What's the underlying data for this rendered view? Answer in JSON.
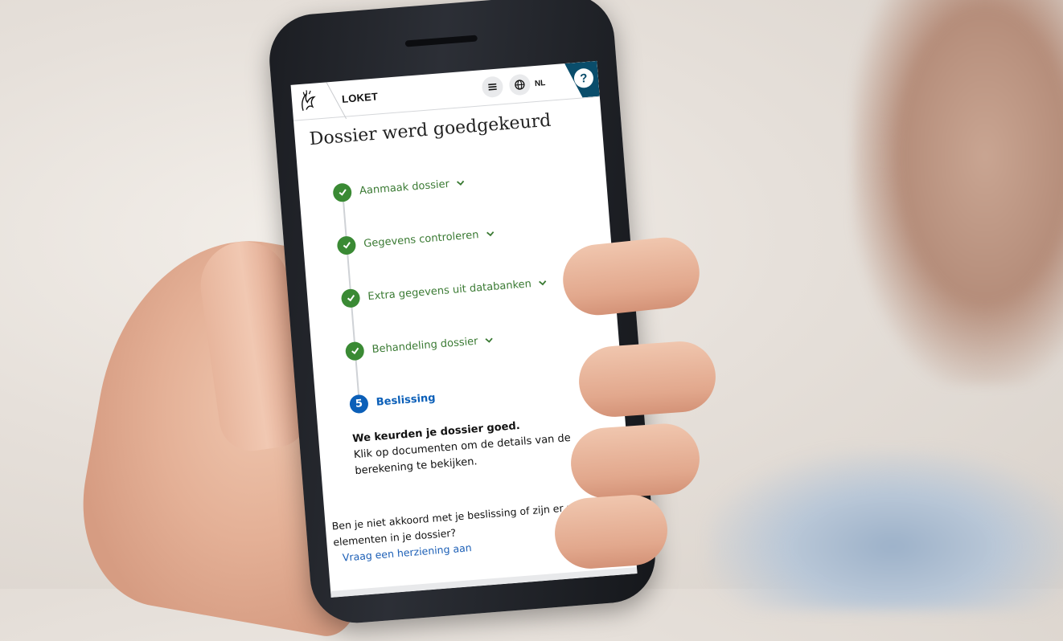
{
  "header": {
    "app_title": "LOKET",
    "language": "NL",
    "help_symbol": "?"
  },
  "page": {
    "title": "Dossier werd goedgekeurd"
  },
  "timeline": {
    "steps": [
      {
        "label": "Aanmaak dossier",
        "status": "completed",
        "icon": "check-icon"
      },
      {
        "label": "Gegevens controleren",
        "status": "completed",
        "icon": "check-icon"
      },
      {
        "label": "Extra gegevens uit databanken",
        "status": "completed",
        "icon": "check-icon"
      },
      {
        "label": "Behandeling dossier",
        "status": "completed",
        "icon": "check-icon"
      }
    ],
    "current": {
      "number": "5",
      "label": "Beslissing"
    }
  },
  "decision": {
    "headline": "We keurden je dossier goed.",
    "body": "Klik op documenten om de details van de berekening te bekijken."
  },
  "review": {
    "question": "Ben je niet akkoord met je beslissing of zijn er nieuwe elementen in je dossier?",
    "link_label": "Vraag een herziening aan"
  },
  "colors": {
    "completed_green": "#3a8a34",
    "current_blue": "#0b5fb8",
    "header_accent": "#0a4d6b",
    "link_blue": "#1c5fb6"
  }
}
